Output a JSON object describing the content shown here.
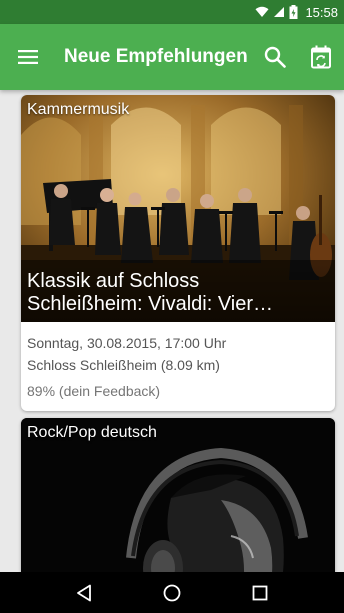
{
  "status_bar": {
    "time": "15:58"
  },
  "app_bar": {
    "title": "Neue Empfehlungen",
    "menu_icon": "hamburger-menu-icon",
    "search_icon": "search-icon",
    "calendar_icon": "calendar-refresh-icon",
    "color": "#4caf50",
    "status_color": "#2f7d32"
  },
  "cards": [
    {
      "category": "Kammermusik",
      "title_line1": "Klassik auf Schloss",
      "title_line2": "Schleißheim: Vivaldi: Vier…",
      "date": "Sonntag, 30.08.2015, 17:00 Uhr",
      "location": "Schloss Schleißheim (8.09 km)",
      "feedback": "89% (dein Feedback)"
    },
    {
      "category": "Rock/Pop deutsch"
    }
  ],
  "nav_bar": {
    "back_icon": "back-triangle-icon",
    "home_icon": "home-circle-icon",
    "recents_icon": "recents-square-icon"
  }
}
